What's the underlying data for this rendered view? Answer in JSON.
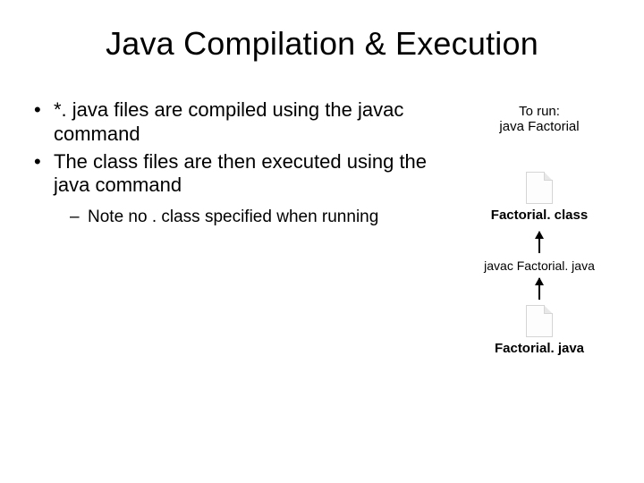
{
  "title": "Java Compilation & Execution",
  "bullets": {
    "b1": "*. java files are compiled using the javac command",
    "b2": "The class files are then executed using the java command",
    "sub1": "Note no . class specified when running"
  },
  "right": {
    "run_line1": "To run:",
    "run_line2": "java Factorial",
    "file_class": "Factorial. class",
    "cmd_compile": "javac Factorial. java",
    "file_java": "Factorial. java"
  }
}
